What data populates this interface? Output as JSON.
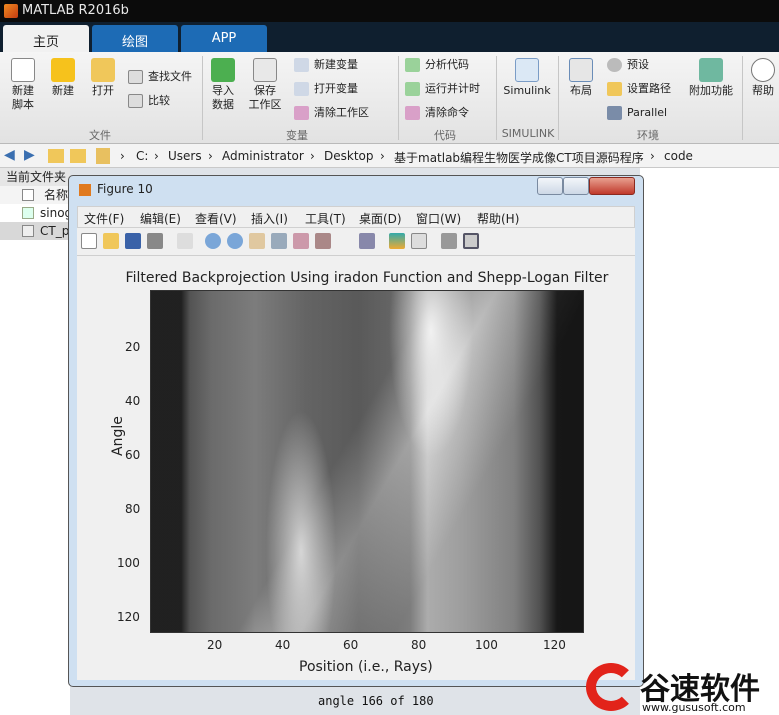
{
  "app": {
    "title": "MATLAB R2016b"
  },
  "tabs": [
    "主页",
    "绘图",
    "APP"
  ],
  "ribbon": {
    "new_script": "新建\n脚本",
    "new": "新建",
    "open": "打开",
    "find_files": "查找文件",
    "compare": "比较",
    "import_data": "导入\n数据",
    "save_workspace": "保存\n工作区",
    "new_variable": "新建变量",
    "open_variable": "打开变量",
    "clear_workspace": "清除工作区",
    "analyze_code": "分析代码",
    "run_time": "运行并计时",
    "clear_commands": "清除命令",
    "simulink": "Simulink",
    "layout": "布局",
    "preferences": "预设",
    "set_path": "设置路径",
    "parallel": "Parallel",
    "addons": "附加功能",
    "help": "帮助",
    "sections": [
      "文件",
      "变量",
      "代码",
      "SIMULINK",
      "环境"
    ]
  },
  "address": [
    "C:",
    "Users",
    "Administrator",
    "Desktop",
    "基于matlab编程生物医学成像CT项目源码程序",
    "code"
  ],
  "left_panel": {
    "header": "当前文件夹",
    "col_name": "名称",
    "files": [
      "sinog",
      "CT_p"
    ]
  },
  "command_line": "angle 166 of 180",
  "figure": {
    "title": "Figure 10",
    "menus": [
      "文件(F)",
      "编辑(E)",
      "查看(V)",
      "插入(I)",
      "工具(T)",
      "桌面(D)",
      "窗口(W)",
      "帮助(H)"
    ]
  },
  "chart_data": {
    "type": "heatmap",
    "title": "Filtered Backprojection Using iradon Function and Shepp-Logan Filter",
    "xlabel": "Position (i.e., Rays)",
    "ylabel": "Angle",
    "xlim": [
      1,
      128
    ],
    "ylim": [
      1,
      128
    ],
    "xticks": [
      20,
      40,
      60,
      80,
      100,
      120
    ],
    "yticks": [
      20,
      40,
      60,
      80,
      100,
      120
    ],
    "colormap": "gray"
  },
  "logo": {
    "text": "谷速软件",
    "url": "www.gususoft.com"
  }
}
